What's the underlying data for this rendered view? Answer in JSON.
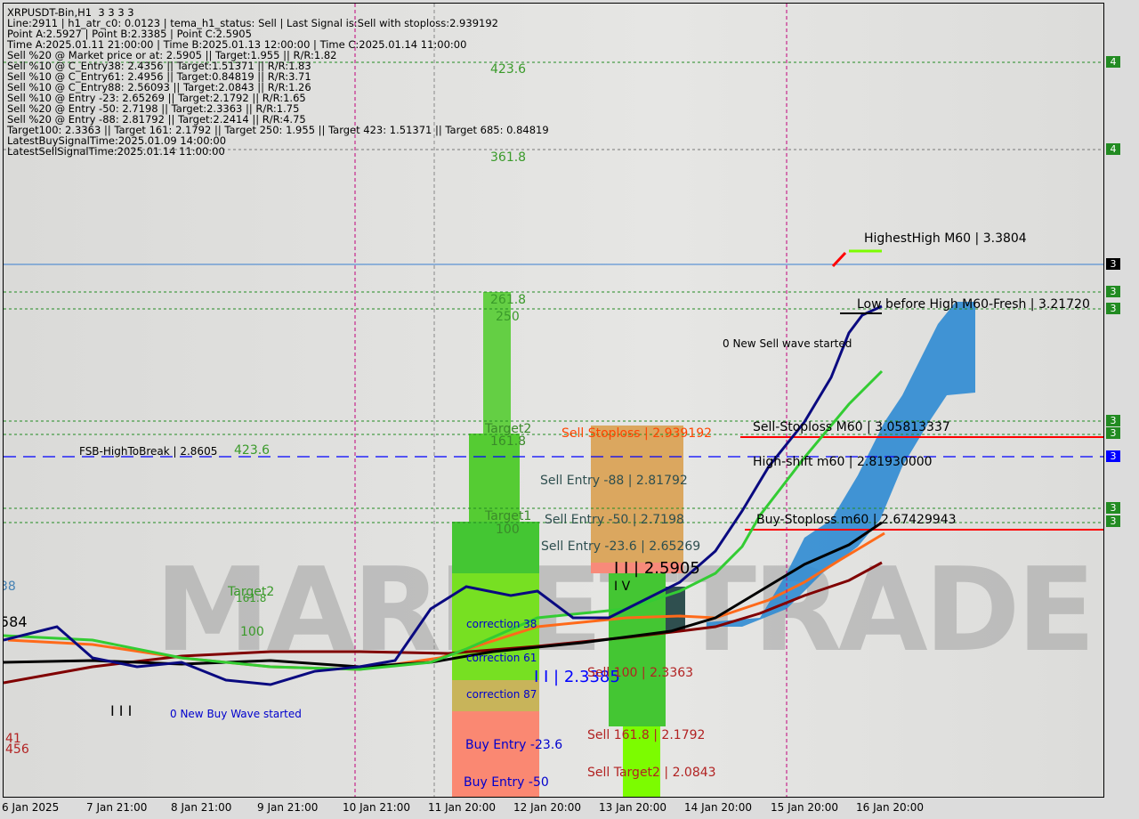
{
  "symbol": "XRPUSDT-Bin,H1  3 3 3 3",
  "info_lines": [
    "Line:2911 | h1_atr_c0: 0.0123 | tema_h1_status: Sell | Last Signal is:Sell with stoploss:2.939192",
    "Point A:2.5927 | Point B:2.3385 | Point C:2.5905",
    "Time A:2025.01.11 21:00:00 | Time B:2025.01.13 12:00:00 | Time C:2025.01.14 11:00:00",
    "Sell %20 @ Market price or at: 2.5905 || Target:1.955 || R/R:1.82",
    "Sell %10 @ C_Entry38: 2.4356 || Target:1.51371 || R/R:1.83",
    "Sell %10 @ C_Entry61: 2.4956 || Target:0.84819 || R/R:3.71",
    "Sell %10 @ C_Entry88: 2.56093 || Target:2.0843 || R/R:1.26",
    "Sell %10 @ Entry -23: 2.65269 || Target:2.1792 || R/R:1.65",
    "Sell %20 @ Entry -50: 2.7198 || Target:2.3363 || R/R:1.75",
    "Sell %20 @ Entry -88: 2.81792 || Target:2.2414 || R/R:4.75",
    "Target100: 2.3363 || Target 161: 2.1792 || Target 250: 1.955 || Target 423: 1.51371 || Target 685: 0.84819",
    "LatestBuySignalTime:2025.01.09 14:00:00",
    "LatestSellSignalTime:2025.01.14 11:00:00"
  ],
  "watermark": "MARKETTRADE",
  "labels": {
    "fib_423_top": "423.6",
    "fib_361": "361.8",
    "fib_261": "261.8",
    "fib_250": "250",
    "target2": "Target2",
    "fib_161": "161.8",
    "target1": "Target1",
    "fib_100": "100",
    "fsb": "FSB-HighToBreak | 2.8605",
    "fsb_423": "423.6",
    "sell_stoploss": "Sell Stoploss | 2.939192",
    "sell_entry_88": "Sell Entry -88 | 2.81792",
    "sell_entry_50": "Sell Entry -50 | 2.7198",
    "sell_entry_236": "Sell Entry -23.6 | 2.65269",
    "point_c": "I I | 2.5905",
    "wave_iv": "I V",
    "correction38": "correction 38",
    "correction61": "correction 61",
    "correction87": "correction 87",
    "point_b": "I I | 2.3385",
    "sell_100": "Sell 100 | 2.3363",
    "sell_161": "Sell 161.8 | 2.1792",
    "sell_target2": "Sell Target2 | 2.0843",
    "buy_entry_236": "Buy Entry -23.6",
    "buy_entry_50": "Buy Entry -50",
    "highest_high": "HighestHigh    M60 | 3.3804",
    "low_before_high": "Low before High   M60-Fresh | 3.21720",
    "new_sell_wave": "0 New Sell wave started",
    "sell_stoploss_m60": "Sell-Stoploss M60 | 3.05813337",
    "high_shift": "High-shift m60 | 2.81930000",
    "buy_stoploss_m60": "Buy-Stoploss m60 | 2.67429943",
    "new_buy_wave": "0 New Buy Wave started",
    "left_target2": "Target2",
    "left_161": "161.8",
    "left_100": "100",
    "left_iii": "I I I",
    "left_584": "584",
    "left_38": "38",
    "left_41": "41",
    "left_456": "456"
  },
  "price_axis": [
    "4",
    "4",
    "3",
    "3",
    "3",
    "3",
    "3",
    "3",
    "3",
    "3"
  ],
  "time_axis": [
    "6 Jan 2025",
    "7 Jan 21:00",
    "8 Jan 21:00",
    "9 Jan 21:00",
    "10 Jan 21:00",
    "11 Jan 20:00",
    "12 Jan 20:00",
    "13 Jan 20:00",
    "14 Jan 20:00",
    "15 Jan 20:00",
    "16 Jan 20:00"
  ],
  "colors": {
    "bull": "#228b22",
    "current_price": "#000000",
    "blue_level": "#0000ff",
    "stoploss": "#ff0000",
    "sell_text": "#b22222",
    "buy_text": "#0000cd"
  }
}
